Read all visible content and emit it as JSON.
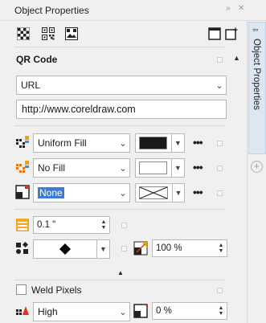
{
  "panel": {
    "title": "Object Properties",
    "title_controls": "» ✕",
    "side_tab_label": "Object Properties"
  },
  "qr": {
    "heading": "QR Code",
    "type_value": "URL",
    "url_value": "http://www.coreldraw.com"
  },
  "fill_rows": [
    {
      "value": "Uniform Fill",
      "swatch": "#1a1a1a"
    },
    {
      "value": "No Fill",
      "swatch": "#ffffff"
    },
    {
      "value": "None",
      "swatch": "x-pattern"
    }
  ],
  "outline": {
    "width_value": "0.1 \"",
    "shape": "diamond",
    "scale_value": "100 %"
  },
  "weld": {
    "label": "Weld Pixels",
    "quality_value": "High",
    "roundness_value": "0 %"
  },
  "colors": {
    "accent": "#1c5ec9",
    "selected_text_bg": "#3f7bd6",
    "side_tab_bg": "#dde7f3"
  }
}
